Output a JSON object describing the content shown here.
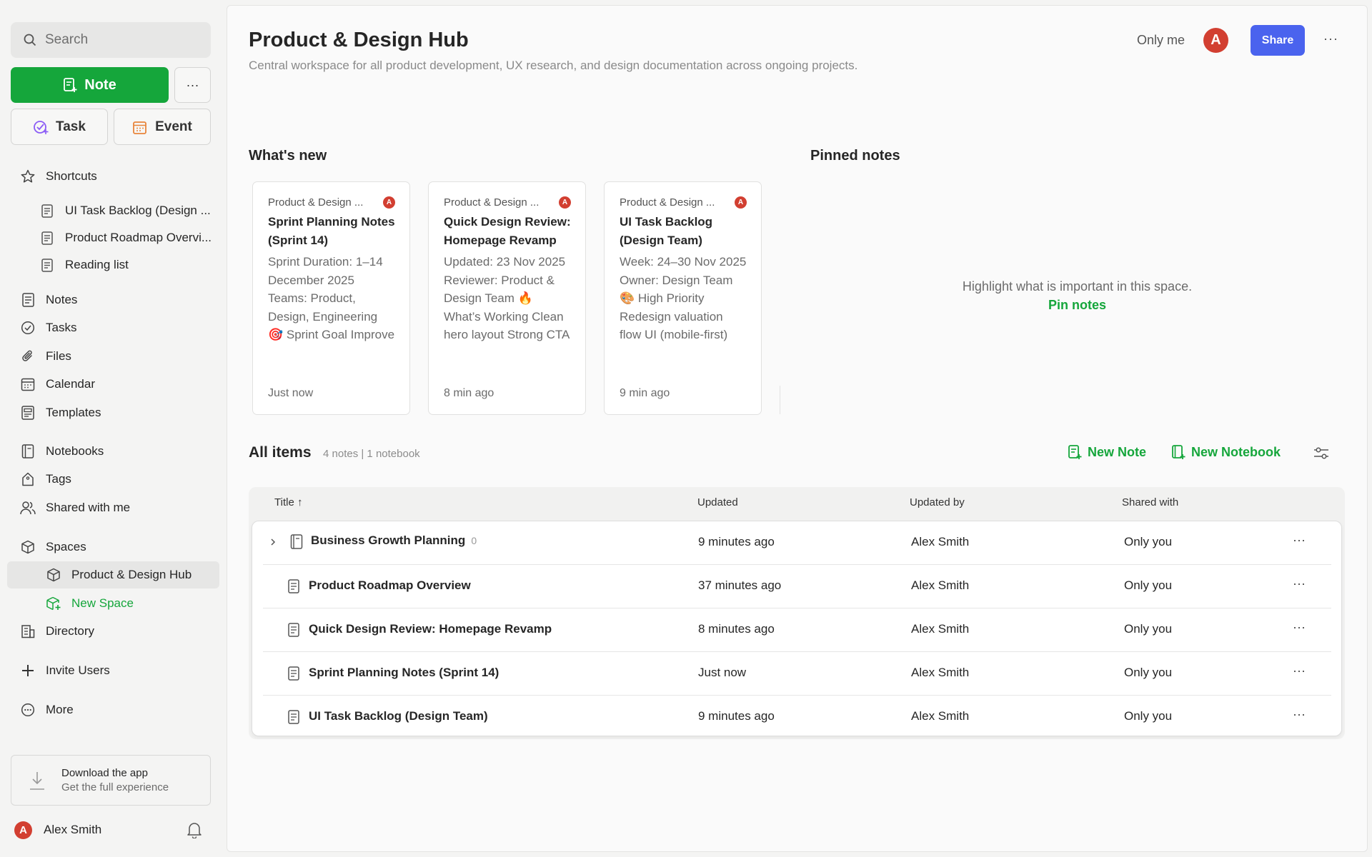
{
  "sidebar": {
    "search_placeholder": "Search",
    "note_button": "Note",
    "more_button": "···",
    "task_button": "Task",
    "event_button": "Event",
    "shortcuts_label": "Shortcuts",
    "shortcuts": [
      "UI Task Backlog (Design ...",
      "Product Roadmap Overvi...",
      "Reading list"
    ],
    "nav": {
      "notes": "Notes",
      "tasks": "Tasks",
      "files": "Files",
      "calendar": "Calendar",
      "templates": "Templates",
      "notebooks": "Notebooks",
      "tags": "Tags",
      "shared": "Shared with me",
      "spaces": "Spaces",
      "space_active": "Product & Design Hub",
      "new_space": "New Space",
      "directory": "Directory",
      "invite": "Invite Users",
      "more": "More"
    },
    "download_title": "Download the app",
    "download_sub": "Get the full experience",
    "user_initial": "A",
    "user_name": "Alex Smith"
  },
  "header": {
    "title": "Product & Design Hub",
    "subtitle": "Central workspace for all product development, UX research, and design documentation across ongoing projects.",
    "visibility": "Only me",
    "avatar_initial": "A",
    "share_label": "Share",
    "more": "···"
  },
  "whats_new": {
    "heading": "What's new",
    "cards": [
      {
        "space": "Product & Design ...",
        "initial": "A",
        "title": "Sprint Planning Notes (Sprint 14)",
        "body": "Sprint Duration: 1–14 December 2025 Teams: Product, Design, Engineering 🎯 Sprint Goal Improve seller conversion by...",
        "time": "Just now"
      },
      {
        "space": "Product & Design ...",
        "initial": "A",
        "title": "Quick Design Review: Homepage Revamp",
        "body": "Updated: 23 Nov 2025 Reviewer: Product & Design Team 🔥 What’s Working Clean hero layout Strong CTA focus Good vis...",
        "time": "8 min ago"
      },
      {
        "space": "Product & Design ...",
        "initial": "A",
        "title": "UI Task Backlog (Design Team)",
        "body": "Week: 24–30 Nov 2025 Owner: Design Team 🎨 High Priority Redesign valuation flow UI (mobile-first) Create dealer badge...",
        "time": "9 min ago"
      }
    ]
  },
  "pinned": {
    "heading": "Pinned notes",
    "empty_text": "Highlight what is important in this space.",
    "link": "Pin notes"
  },
  "all_items": {
    "heading": "All items",
    "counts": "4 notes | 1 notebook",
    "new_note": "New Note",
    "new_notebook": "New Notebook",
    "columns": {
      "title": "Title ↑",
      "updated": "Updated",
      "updated_by": "Updated by",
      "shared": "Shared with"
    },
    "rows": [
      {
        "title": "Business Growth Planning",
        "count": "0",
        "updated": "9 minutes ago",
        "by": "Alex Smith",
        "shared": "Only you",
        "type": "notebook"
      },
      {
        "title": "Product Roadmap Overview",
        "updated": "37 minutes ago",
        "by": "Alex Smith",
        "shared": "Only you",
        "type": "note"
      },
      {
        "title": "Quick Design Review: Homepage Revamp",
        "updated": "8 minutes ago",
        "by": "Alex Smith",
        "shared": "Only you",
        "type": "note"
      },
      {
        "title": "Sprint Planning Notes (Sprint 14)",
        "updated": "Just now",
        "by": "Alex Smith",
        "shared": "Only you",
        "type": "note"
      },
      {
        "title": "UI Task Backlog (Design Team)",
        "updated": "9 minutes ago",
        "by": "Alex Smith",
        "shared": "Only you",
        "type": "note"
      }
    ]
  },
  "colors": {
    "accent": "#15a63b",
    "share": "#4a63ee",
    "avatar": "#d23f31"
  }
}
